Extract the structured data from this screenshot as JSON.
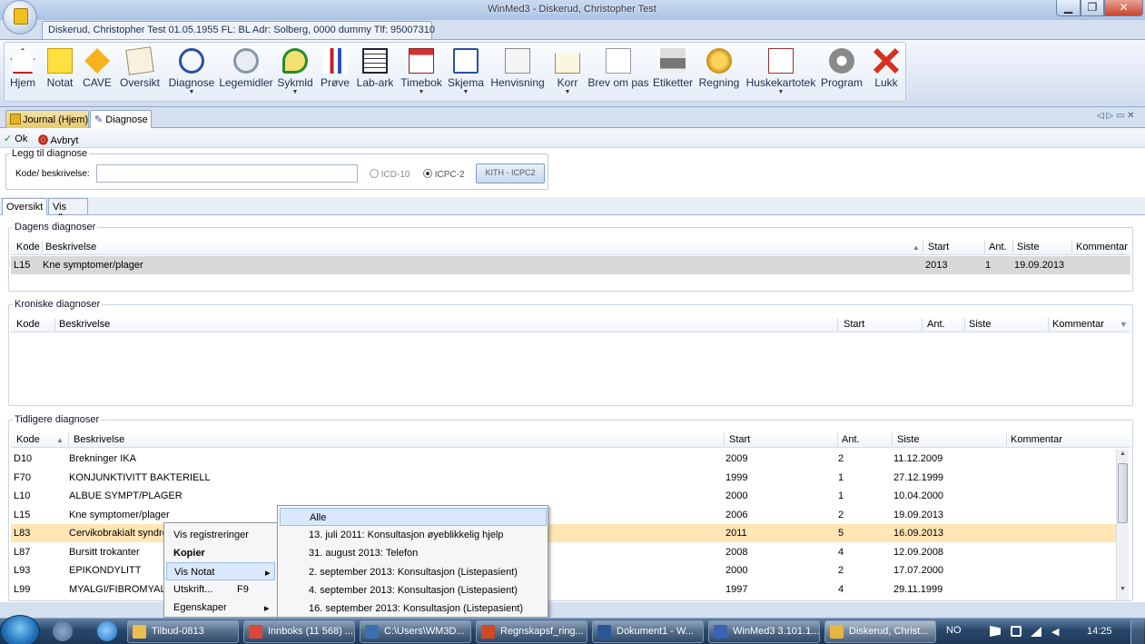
{
  "window": {
    "title": "WinMed3 - Diskerud, Christopher Test",
    "min_glyph": "▁",
    "max_glyph": "❐",
    "close_glyph": "✕"
  },
  "patient_tab": "Diskerud, Christopher Test 01.05.1955 FL: BL Adr: Solberg, 0000 dummy Tlf: 95007310",
  "ribbon": {
    "buttons": [
      {
        "label": "Hjem",
        "icon": "home-icon",
        "dropdown": false
      },
      {
        "label": "Notat",
        "icon": "note-icon",
        "dropdown": false
      },
      {
        "label": "CAVE",
        "icon": "warning-icon",
        "dropdown": false
      },
      {
        "label": "Oversikt",
        "icon": "overview-icon",
        "dropdown": false
      },
      {
        "label": "Diagnose",
        "icon": "stethoscope-icon",
        "dropdown": true
      },
      {
        "label": "Legemidler",
        "icon": "medicine-icon",
        "dropdown": false
      },
      {
        "label": "Sykmld",
        "icon": "wheelchair-icon",
        "dropdown": true
      },
      {
        "label": "Prøve",
        "icon": "test-tube-icon",
        "dropdown": false
      },
      {
        "label": "Lab-ark",
        "icon": "lab-sheet-icon",
        "dropdown": false
      },
      {
        "label": "Timebok",
        "icon": "calendar-icon",
        "dropdown": true
      },
      {
        "label": "Skjema",
        "icon": "form-icon",
        "dropdown": true
      },
      {
        "label": "Henvisning",
        "icon": "referral-icon",
        "dropdown": false
      },
      {
        "label": "Korr",
        "icon": "envelope-icon",
        "dropdown": true
      },
      {
        "label": "Brev om pas",
        "icon": "letter-icon",
        "dropdown": false
      },
      {
        "label": "Etiketter",
        "icon": "printer-icon",
        "dropdown": false
      },
      {
        "label": "Regning",
        "icon": "coins-icon",
        "dropdown": false
      },
      {
        "label": "Huskekartotek",
        "icon": "checklist-icon",
        "dropdown": true
      },
      {
        "label": "Program",
        "icon": "gear-icon",
        "dropdown": false
      },
      {
        "label": "Lukk",
        "icon": "close-x-icon",
        "dropdown": false
      }
    ],
    "dropdown_glyph": "▼"
  },
  "doc_tabs": {
    "journal": "Journal (Hjem)",
    "diagnose": "Diagnose",
    "nav": "◁ ▷ ▭ ✕"
  },
  "toolbar": {
    "ok": "Ok",
    "cancel": "Avbryt",
    "ok_glyph": "✓",
    "cancel_glyph": "⓿"
  },
  "add_diagnosis": {
    "title": "Legg til diagnose",
    "code_label": "Kode/ beskrivelse:",
    "code_value": "",
    "icd10": "ICD-10",
    "icpc2": "ICPC-2",
    "selected": "ICPC-2",
    "kith_button": "KITH - ICPC2"
  },
  "subtabs": {
    "oversikt": "Oversikt",
    "vis_alle": "Vis alle"
  },
  "todays": {
    "title": "Dagens diagnoser",
    "headers": {
      "kode": "Kode",
      "beskrivelse": "Beskrivelse",
      "start": "Start",
      "ant": "Ant.",
      "siste": "Siste",
      "kommentar": "Kommentar"
    },
    "rows": [
      {
        "kode": "L15",
        "beskrivelse": "Kne symptomer/plager",
        "start": "2013",
        "ant": "1",
        "siste": "19.09.2013",
        "kommentar": ""
      }
    ]
  },
  "chronic": {
    "title": "Kroniske diagnoser",
    "headers": {
      "kode": "Kode",
      "beskrivelse": "Beskrivelse",
      "start": "Start",
      "ant": "Ant.",
      "siste": "Siste",
      "kommentar": "Kommentar"
    }
  },
  "previous": {
    "title": "Tidligere diagnoser",
    "headers": {
      "kode": "Kode",
      "beskrivelse": "Beskrivelse",
      "start": "Start",
      "ant": "Ant.",
      "siste": "Siste",
      "kommentar": "Kommentar"
    },
    "rows": [
      {
        "kode": "D10",
        "beskrivelse": "Brekninger IKA",
        "start": "2009",
        "ant": "2",
        "siste": "11.12.2009"
      },
      {
        "kode": "F70",
        "beskrivelse": "KONJUNKTIVITT BAKTERIELL",
        "start": "1999",
        "ant": "1",
        "siste": "27.12.1999"
      },
      {
        "kode": "L10",
        "beskrivelse": "ALBUE SYMPT/PLAGER",
        "start": "2000",
        "ant": "1",
        "siste": "10.04.2000"
      },
      {
        "kode": "L15",
        "beskrivelse": "Kne symptomer/plager",
        "start": "2006",
        "ant": "2",
        "siste": "19.09.2013"
      },
      {
        "kode": "L83",
        "beskrivelse": "Cervikobrakialt syndrom",
        "start": "2011",
        "ant": "5",
        "siste": "16.09.2013"
      },
      {
        "kode": "L87",
        "beskrivelse": "Bursitt trokanter",
        "start": "2008",
        "ant": "4",
        "siste": "12.09.2008"
      },
      {
        "kode": "L93",
        "beskrivelse": "EPIKONDYLITT",
        "start": "2000",
        "ant": "2",
        "siste": "17.07.2000"
      },
      {
        "kode": "L99",
        "beskrivelse": "MYALGI/FIBROMYALGI",
        "start": "1997",
        "ant": "4",
        "siste": "29.11.1999"
      }
    ],
    "selected_index": 4
  },
  "context_menu": {
    "items": [
      {
        "label": "Vis registreringer",
        "shortcut": "",
        "submenu": false,
        "bold": false
      },
      {
        "label": "Kopier",
        "shortcut": "",
        "submenu": false,
        "bold": true
      },
      {
        "label": "Vis Notat",
        "shortcut": "",
        "submenu": true,
        "bold": false
      },
      {
        "label": "Utskrift...",
        "shortcut": "F9",
        "submenu": false,
        "bold": false
      },
      {
        "label": "Egenskaper",
        "shortcut": "",
        "submenu": true,
        "bold": false
      }
    ],
    "arrow_glyph": "▸"
  },
  "submenu": {
    "items": [
      "Alle",
      "13. juli 2011: Konsultasjon øyeblikkelig hjelp",
      "31. august 2013: Telefon",
      "2. september 2013: Konsultasjon (Listepasient)",
      "4. september 2013: Konsultasjon (Listepasient)",
      "16. september 2013: Konsultasjon (Listepasient)"
    ]
  },
  "taskbar": {
    "items": [
      {
        "label": "Tilbud-0813",
        "color": "#e8c050"
      },
      {
        "label": "Innboks (11 568) ...",
        "color": "#d9463a"
      },
      {
        "label": "C:\\Users\\WM3D...",
        "color": "#3a6fb0"
      },
      {
        "label": "Regnskapsf_ring...",
        "color": "#d04a25"
      },
      {
        "label": "Dokument1 - W...",
        "color": "#2b5797"
      },
      {
        "label": "WinMed3 3.101.1...",
        "color": "#3b64b8"
      },
      {
        "label": "Diskerud, Christ...",
        "color": "#e6b640"
      }
    ],
    "lang": "NO",
    "time": "14:25"
  },
  "colors": {
    "accent": "#ffde9a",
    "selected_row": "#ffe6b4",
    "today_row": "#d8d8d8"
  }
}
